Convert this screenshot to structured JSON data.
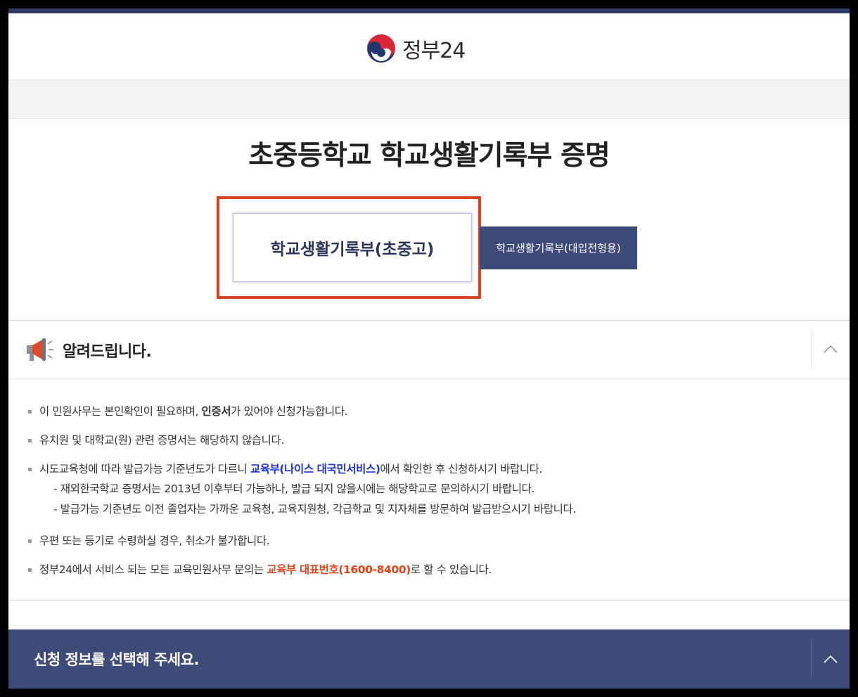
{
  "header": {
    "logo_text": "정부24",
    "colors": {
      "top_line": "#2c3a64",
      "logo_red": "#d9263a",
      "logo_blue": "#23356f"
    }
  },
  "page_title": "초중등학교 학교생활기록부 증명",
  "tabs": [
    {
      "label": "학교생활기록부(초중고)",
      "selected": true
    },
    {
      "label": "학교생활기록부(대입전형용)",
      "selected": false
    }
  ],
  "notice": {
    "icon": "megaphone-icon",
    "title": "알려드립니다.",
    "items": [
      {
        "before": "이 민원사무는 본인확인이 필요하며, ",
        "bold": "인증서",
        "after": "가 있어야 신청가능합니다."
      },
      {
        "text": "유치원 및 대학교(원) 관련 증명서는 해당하지 않습니다."
      },
      {
        "before": "시도교육청에 따라 발급가능 기준년도가 다르니 ",
        "link": "교육부(나이스 대국민서비스)",
        "after": "에서 확인한 후 신청하시기 바랍니다.",
        "sub": [
          "- 재외한국학교 증명서는 2013년 이후부터 가능하나, 발급 되지 않을시에는 해당학교로 문의하시기 바랍니다.",
          "- 발급가능 기준년도 이전 졸업자는 가까운 교육청, 교육지원청, 각급학교 및 지자체를 방문하여 발급받으시기 바랍니다."
        ]
      },
      {
        "text": "우편 또는 등기로 수령하실 경우, 취소가 불가합니다."
      },
      {
        "before": "정부24에서 서비스 되는 모든 교육민원사무 문의는 ",
        "highlight": "교육부 대표번호(1600-8400)",
        "after": "로 할 수 있습니다."
      }
    ]
  },
  "apply_section": {
    "title": "신청 정보를 선택해 주세요."
  },
  "colors": {
    "accent_navy": "#3d4b7a",
    "highlight_border": "#e0401e",
    "link_blue": "#1e32e0",
    "phone_red": "#e5431a"
  }
}
